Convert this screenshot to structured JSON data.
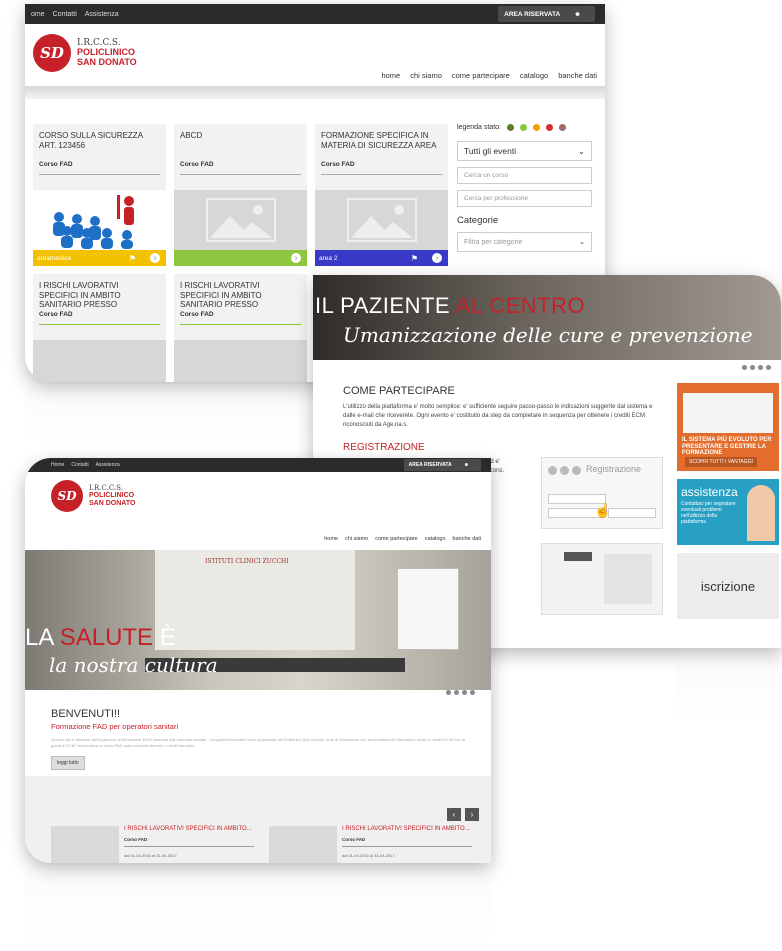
{
  "shot1": {
    "topbar": {
      "links": [
        "ome",
        "Contatti",
        "Assistenza"
      ],
      "area_btn": "AREA RISERVATA"
    },
    "logo": {
      "initials": "SD",
      "line1": "I.R.C.C.S.",
      "line2": "POLICLINICO",
      "line3": "SAN DONATO"
    },
    "nav": [
      "home",
      "chi siamo",
      "come partecipare",
      "catalogo",
      "banche dati"
    ],
    "cards": [
      {
        "title": "CORSO SULLA SICUREZZA ART. 123456",
        "sub": "Corso FAD",
        "footer": "areamedica",
        "footer_color": "#f2c200"
      },
      {
        "title": "ABCD",
        "sub": "Corso FAD",
        "footer": "",
        "footer_color": "#8dc63f"
      },
      {
        "title": "FORMAZIONE SPECIFICA IN MATERIA DI SICUREZZA AREA",
        "sub": "Corso FAD",
        "footer": "area 2",
        "footer_color": "#3a3ac8"
      },
      {
        "title": "I RISCHI LAVORATIVI SPECIFICI IN AMBITO SANITARIO PRESSO",
        "sub": "Corso FAD",
        "footer": "",
        "footer_color": "#f2f2f2"
      },
      {
        "title": "I RISCHI LAVORATIVI SPECIFICI IN AMBITO SANITARIO PRESSO",
        "sub": "Corso FAD",
        "footer": "",
        "footer_color": "#f2f2f2"
      }
    ],
    "sidebar": {
      "legend_label": "legenda stato:",
      "legend_colors": [
        "#5a7d2a",
        "#8dc63f",
        "#f2a000",
        "#d32f2f",
        "#a06a6a"
      ],
      "select_events": "Tutti gli eventi",
      "search_course": "Cerca un corso",
      "search_profession": "Cerca per professione",
      "categories_heading": "Categorie",
      "category_filter": "Filtra per categorie"
    }
  },
  "shot2": {
    "banner": {
      "line1_a": "IL PAZIENTE ",
      "line1_b": "AL CENTRO",
      "line2": "Umanizzazione delle cure e prevenzione"
    },
    "heading": "COME PARTECIPARE",
    "intro": "L'utilizzo della piattaforma e' molto semplice: e' sufficiente seguire passo-passo le indicazioni suggerite dal sistema e dalle e-mail che riceverete. Ogni evento e' costituito da step da completare in sequenza per ottenere i crediti ECM riconosciuti da Age.na.s.",
    "reg_heading": "REGISTRAZIONE",
    "reg_text": "La registrazione al sito va eseguita solo la prima volta ed e' indispensabile per poter richiedere la partecipazione ai corsi.",
    "reg_panel": "Registrazione",
    "ads": {
      "ad1_title": "IL SISTEMA PIÙ EVOLUTO PER PRESENTARE E GESTIRE LA FORMAZIONE",
      "ad1_btn": "SCOPRI TUTTI I VANTAGGI",
      "ad2_title": "assistenza",
      "ad2_text": "Contattaci per segnalare eventuali problemi nell'utilizzo della piattaforma",
      "ad3_title": "iscrizione"
    }
  },
  "shot3": {
    "topbar": {
      "links": [
        "Home",
        "Contatti",
        "Assistenza"
      ],
      "area_btn": "AREA RISERVATA"
    },
    "logo": {
      "initials": "SD",
      "line1": "I.R.C.C.S.",
      "line2": "POLICLINICO",
      "line3": "SAN DONATO"
    },
    "nav": [
      "home",
      "chi siamo",
      "come partecipare",
      "catalogo",
      "banche dati"
    ],
    "hero": {
      "wall_text": "ISTITUTI CLINICI ZUCCHI",
      "line1_a": "LA ",
      "line1_b": "SALUTE",
      "line1_c": " È",
      "line2": "la nostra cultura"
    },
    "welcome": {
      "title": "BENVENUTI!!",
      "subtitle": "Formazione FAD per operatori sanitari",
      "text": "Questo sito è dedicato all'erogazione di formazione ECM riservata agli operatori sanitari. I programmi formativi sono organizzati dal Policlinico San Donato, ente di formazione con accreditamento Standard e rivolti ai medici ECM con la guida di ECM. Iscrivendosi al corso FAD sarà possibile ottenere i crediti formativi.",
      "button": "leggi tutto"
    },
    "events": [
      {
        "title": "I RISCHI LAVORATIVI SPECIFICI IN AMBITO...",
        "sub": "Corso FAD",
        "date": "dal 01-04-2016 al 31-04-2017"
      },
      {
        "title": "I RISCHI LAVORATIVI SPECIFICI IN AMBITO...",
        "sub": "Corso FAD",
        "date": "dal 01-04-2016 al 31-04-2017"
      }
    ]
  }
}
